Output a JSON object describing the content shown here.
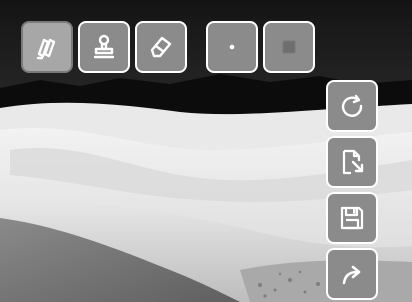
{
  "toolbar_top": [
    {
      "icon": "pencil-icon",
      "name": "draw-tool-button",
      "active": true
    },
    {
      "icon": "stamp-icon",
      "name": "stamp-tool-button",
      "active": false
    },
    {
      "icon": "eraser-icon",
      "name": "eraser-tool-button",
      "active": false
    },
    {
      "icon": "small-brush-icon",
      "name": "small-brush-button",
      "active": false
    },
    {
      "icon": "large-brush-icon",
      "name": "large-brush-button",
      "active": false
    }
  ],
  "toolbar_right": [
    {
      "icon": "rotate-icon",
      "name": "rotate-button"
    },
    {
      "icon": "file-export-icon",
      "name": "export-button"
    },
    {
      "icon": "save-icon",
      "name": "save-button"
    },
    {
      "icon": "forward-arrow-icon",
      "name": "next-button"
    }
  ],
  "colors": {
    "button_fill": "#8b8b8b",
    "button_active_fill": "#a7a7a7",
    "button_border": "#ffffff",
    "icon_color": "#ffffff"
  }
}
